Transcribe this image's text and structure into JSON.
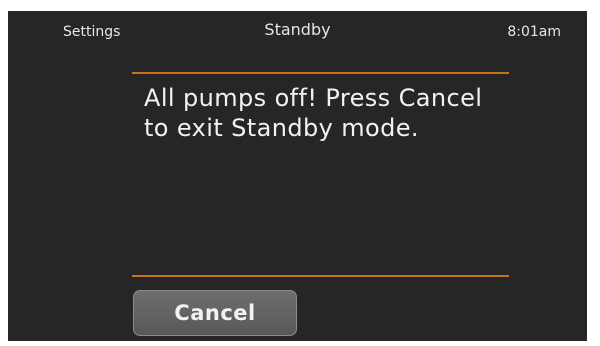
{
  "header": {
    "settings_label": "Settings",
    "title": "Standby",
    "time": "8:01am"
  },
  "message": "All pumps off! Press Cancel to exit Standby mode.",
  "cancel_label": "Cancel",
  "colors": {
    "background": "#262626",
    "accent_rule": "#c8721f",
    "text": "#f2f2f2"
  }
}
